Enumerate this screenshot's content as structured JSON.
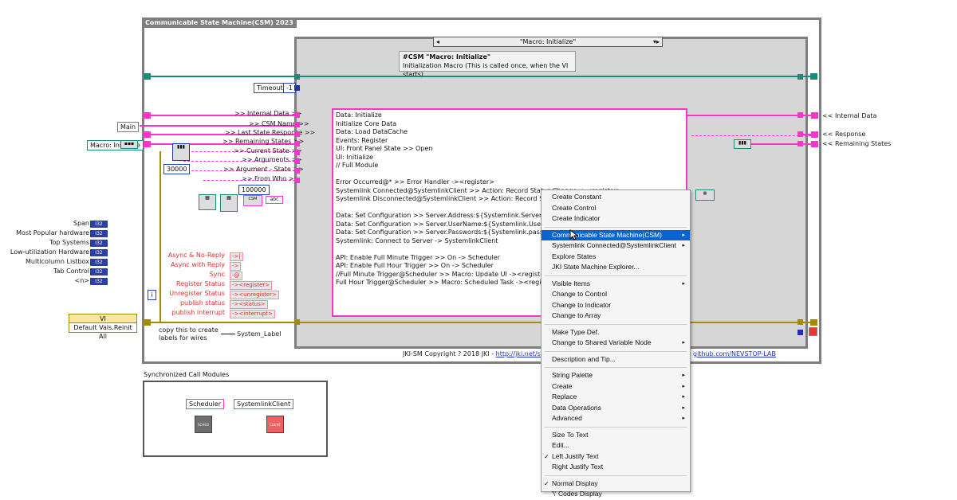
{
  "diagram": {
    "frame_title": "Communicable State Machine(CSM) 2023",
    "case_selector": "\"Macro: Initialize\"",
    "case_comment": {
      "line1": "#CSM \"Macro: Initialize\"",
      "line2": "Initialization Macro (This is called once, when the VI starts)"
    },
    "timeout_label": "Timeout",
    "timeout_value": "-1",
    "left_inputs": {
      "main": "Main",
      "macro_initialize": "Macro: Initialize",
      "const_30000": "30000",
      "const_100000": "100000"
    },
    "unbundle_labels": [
      ">> Internal Data >>",
      ">> CSM Name >>",
      ">> Last State Response >>",
      ">> Remaining States >>",
      ">> Current State >>",
      ">> Arguments >>",
      ">> Argument - State >>",
      ">> From Who >>"
    ],
    "right_outputs": {
      "internal_data": "<< Internal Data",
      "response": "<< Response",
      "remaining_states": "<< Remaining States"
    },
    "data_box_text": "Data: Initialize\nInitialize Core Data\nData: Load DataCache\nEvents: Register\nUI: Front Panel State >> Open\nUI: Initialize\n// Full Module\n\nError Occurred@* >> Error Handler -><register>\nSystemlink Connected@SystemlinkClient >> Action: Record Status Change -><register>\nSystemlink Disconnected@SystemlinkClient >> Action: Record Status\n\nData: Set Configuration >> Server.Address:${Systemlink.Server:127.0.0\nData: Set Configuration >> Server.UserName:${Systemlink.Username\nData: Set Configuration >> Server.Passwords:${Systemlink.passwords\nSystemlink: Connect to Server -> SystemlinkClient\n\nAPI: Enable Full Minute Trigger >> On -> Scheduler\nAPI: Enable Full Hour Trigger >> On -> Scheduler\n//Full Minute Trigger@Scheduler >> Macro: Update UI -><register>\nFull Hour Trigger@Scheduler >> Macro: Scheduled Task -><register>",
    "enum_items": [
      "Span",
      "Most Popular hardware",
      "Top Systems",
      "Low-utilization Hardware",
      "Multicolumn Listbox",
      "Tab Control",
      "<n>"
    ],
    "enum_term_text": "I32",
    "message_types": [
      {
        "label": "Async & No-Reply",
        "const": "->|"
      },
      {
        "label": "Async with Reply",
        "const": "->"
      },
      {
        "label": "Sync",
        "const": "-@"
      },
      {
        "label": "Register Status",
        "const": "-><register>"
      },
      {
        "label": "Unregister Status",
        "const": "-><unregister>"
      },
      {
        "label": "publish status",
        "const": "-><status>"
      },
      {
        "label": "publish interrupt",
        "const": "-><interrupt>"
      }
    ],
    "vi_cluster": {
      "header": "VI",
      "label": "Default Vals.Reinit All"
    },
    "wire_note": "copy this to create\nlabels for wires",
    "system_label": "System_Label",
    "copyright_text": "JKI-SM Copyright ? 2018 JKI - ",
    "copyright_link": "http://jki.net/sta",
    "github_link": "github.com/NEVSTOP-LAB",
    "scm_title": "Synchronized Call Modules",
    "scm_modules": [
      "Scheduler",
      "SystemlinkClient"
    ],
    "i_indicator": "i"
  },
  "context_menu": {
    "items": [
      {
        "label": "Create Constant",
        "submenu": false
      },
      {
        "label": "Create Control",
        "submenu": false
      },
      {
        "label": "Create Indicator",
        "submenu": false
      },
      {
        "sep": true
      },
      {
        "label": "Communicable State Machine(CSM)",
        "submenu": true,
        "highlighted": true
      },
      {
        "label": "Systemlink Connected@SystemlinkClient",
        "submenu": true
      },
      {
        "label": "Explore States",
        "submenu": false
      },
      {
        "label": "JKI State Machine Explorer...",
        "submenu": false
      },
      {
        "sep": true
      },
      {
        "label": "Visible Items",
        "submenu": true
      },
      {
        "label": "Change to Control",
        "submenu": false
      },
      {
        "label": "Change to Indicator",
        "submenu": false
      },
      {
        "label": "Change to Array",
        "submenu": false
      },
      {
        "sep": true
      },
      {
        "label": "Make Type Def.",
        "submenu": false
      },
      {
        "label": "Change to Shared Variable Node",
        "submenu": true
      },
      {
        "sep": true
      },
      {
        "label": "Description and Tip...",
        "submenu": false
      },
      {
        "sep": true
      },
      {
        "label": "String Palette",
        "submenu": true
      },
      {
        "label": "Create",
        "submenu": true
      },
      {
        "label": "Replace",
        "submenu": true
      },
      {
        "label": "Data Operations",
        "submenu": true
      },
      {
        "label": "Advanced",
        "submenu": true
      },
      {
        "sep": true
      },
      {
        "label": "Size To Text",
        "submenu": false
      },
      {
        "label": "Edit...",
        "submenu": false
      },
      {
        "label": "Left Justify Text",
        "submenu": false,
        "checked": true
      },
      {
        "label": "Right Justify Text",
        "submenu": false
      },
      {
        "sep": true
      },
      {
        "label": "Normal Display",
        "submenu": false,
        "checked": true
      },
      {
        "label": "'\\' Codes Display",
        "submenu": false
      }
    ],
    "submenu_arrow": "▸",
    "check_mark": "✓"
  },
  "colors": {
    "string_wire": "#ff33cc",
    "cluster_wire": "#1a8a7a",
    "error_wire": "#a38b00",
    "numeric_wire": "#2233aa",
    "menu_highlight": "#0a64d0",
    "structure_gray": "#7f7f7f"
  }
}
